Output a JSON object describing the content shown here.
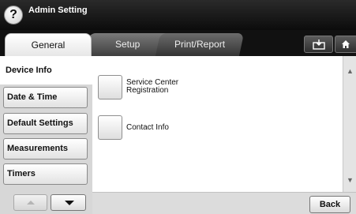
{
  "header": {
    "title": "Admin Setting",
    "help_glyph": "?"
  },
  "tabs": [
    {
      "label": "General",
      "active": true
    },
    {
      "label": "Setup",
      "active": false
    },
    {
      "label": "Print/Report",
      "active": false
    }
  ],
  "toolbar_icons": [
    "tray-icon",
    "home-icon"
  ],
  "sidebar": {
    "items": [
      {
        "label": "Device Info",
        "active": true
      },
      {
        "label": "Date & Time",
        "active": false
      },
      {
        "label": "Default Settings",
        "active": false
      },
      {
        "label": "Measurements",
        "active": false
      },
      {
        "label": "Timers",
        "active": false
      }
    ]
  },
  "options": [
    {
      "label_line1": "Service Center",
      "label_line2": "Registration"
    },
    {
      "label_line1": "Contact Info",
      "label_line2": ""
    }
  ],
  "footer": {
    "back_label": "Back"
  }
}
